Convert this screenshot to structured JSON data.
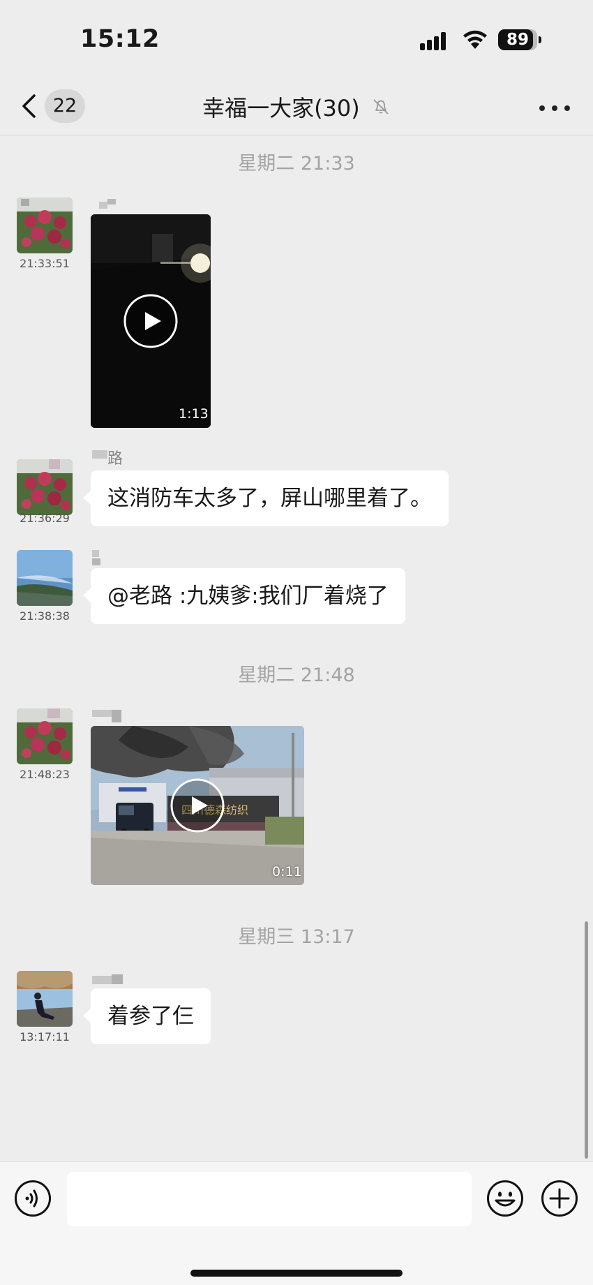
{
  "status_bar": {
    "time": "15:12",
    "battery": "89",
    "battery_level": 0.89
  },
  "nav": {
    "unread_count": "22",
    "title": "幸福一大家(30)",
    "back_icon": "chevron-left-icon",
    "mute_icon": "bell-slash-icon",
    "more_icon": "ellipsis-icon"
  },
  "messages": [
    {
      "divider": "星期二 21:33"
    },
    {
      "time": "21:33:51",
      "type": "video",
      "duration": "1:13"
    },
    {
      "time": "21:36:29",
      "type": "text",
      "sender_visible": "路",
      "text": "这消防车太多了，屏山哪里着了。"
    },
    {
      "time": "21:38:38",
      "type": "text",
      "text": "@老路 :九姨爹:我们厂着烧了"
    },
    {
      "divider": "星期二 21:48"
    },
    {
      "time": "21:48:23",
      "type": "video",
      "duration": "0:11",
      "sign_text": "四川德森纺织"
    },
    {
      "divider": "星期三 13:17"
    },
    {
      "time": "13:17:11",
      "type": "text",
      "text": "着参了仨"
    }
  ],
  "input": {
    "placeholder": "",
    "value": ""
  }
}
